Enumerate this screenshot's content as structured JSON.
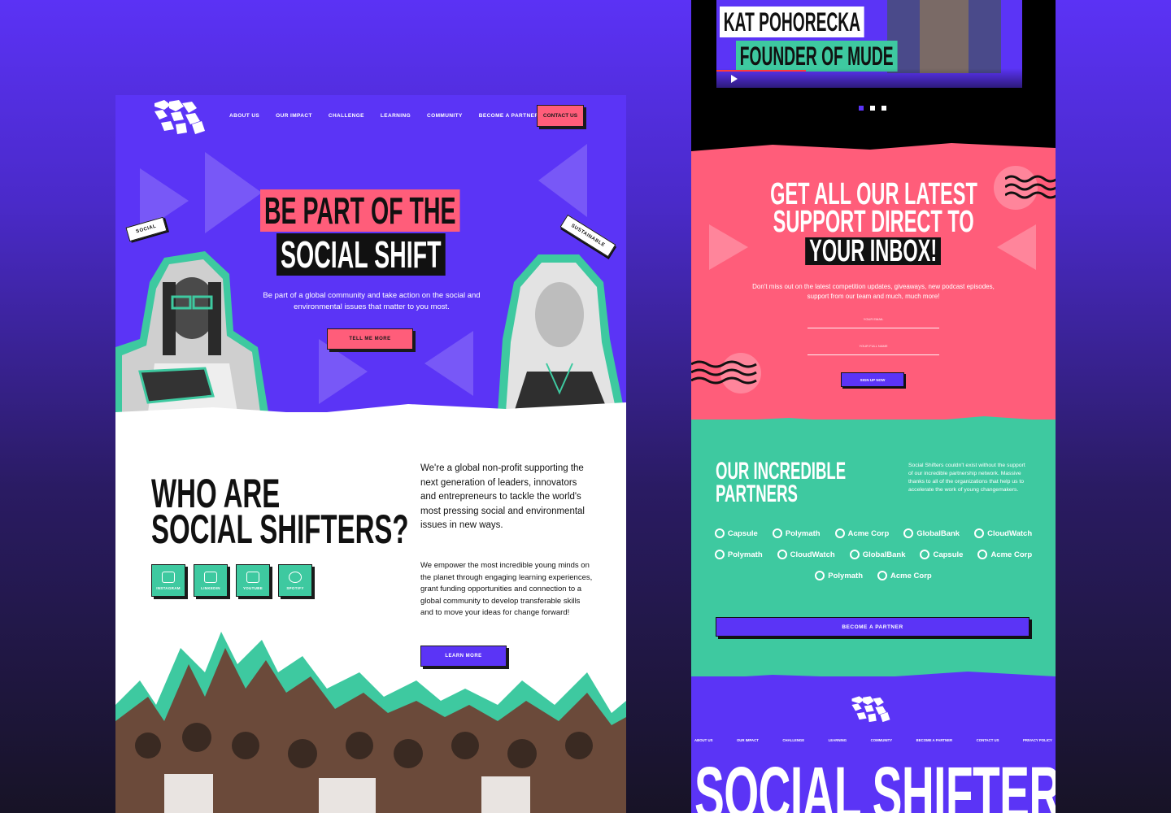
{
  "left_page": {
    "nav": {
      "items": [
        "ABOUT US",
        "OUR IMPACT",
        "CHALLENGE",
        "LEARNING",
        "COMMUNITY",
        "BECOME A PARTNER"
      ],
      "contact_label": "CONTACT US"
    },
    "hero": {
      "title_line1": "BE PART OF THE",
      "title_line2": "SOCIAL SHIFT",
      "subtitle": "Be part of a global community and take action on the social and environmental issues that matter to you most.",
      "cta_label": "TELL ME MORE",
      "tag_left": "SOCIAL",
      "tag_right": "SUSTAINABLE"
    },
    "who": {
      "title_line1": "WHO ARE",
      "title_line2": "SOCIAL SHIFTERS?",
      "para1": "We're a global non-profit supporting the next generation of leaders, innovators and entrepreneurs to tackle the world's most pressing social and environmental issues in new ways.",
      "para2": "We empower the most incredible young minds on the planet through engaging learning experiences, grant funding opportunities and connection to a global community to develop transferable skills and to move your ideas for change forward!",
      "cta_label": "LEARN MORE",
      "socials": [
        "INSTAGRAM",
        "LINKEDIN",
        "YOUTUBE",
        "SPOTIFY"
      ]
    }
  },
  "right_page": {
    "video": {
      "name_label": "KAT POHORECKA",
      "role_label": "FOUNDER OF MUDE"
    },
    "newsletter": {
      "title_line1": "GET ALL OUR LATEST",
      "title_line2": "SUPPORT DIRECT TO",
      "title_line3": "YOUR INBOX!",
      "subtitle": "Don't miss out on the latest competition updates, giveaways, new podcast episodes, support from our team and much, much more!",
      "email_placeholder": "YOUR EMAIL",
      "name_placeholder": "YOUR FULL NAME",
      "cta_label": "SIGN UP NOW"
    },
    "partners": {
      "title_line1": "OUR INCREDIBLE",
      "title_line2": "PARTNERS",
      "description": "Social Shifters couldn't exist without the support of our incredible partnership network. Massive thanks to all of the organizations that help us to accelerate the work of young changemakers.",
      "rows": [
        [
          "Capsule",
          "Polymath",
          "Acme Corp",
          "GlobalBank",
          "CloudWatch"
        ],
        [
          "Polymath",
          "CloudWatch",
          "GlobalBank",
          "Capsule",
          "Acme Corp"
        ],
        [
          "Polymath",
          "Acme Corp"
        ]
      ],
      "cta_label": "BECOME A PARTNER"
    },
    "footer": {
      "nav": [
        "ABOUT US",
        "OUR IMPACT",
        "CHALLENGE",
        "LEARNING",
        "COMMUNITY",
        "BECOME A PARTNER",
        "CONTACT US",
        "PRIVACY POLICY"
      ],
      "brand": "SOCIAL SHIFTERS"
    }
  },
  "colors": {
    "purple": "#5b34f6",
    "pink": "#ff5d7a",
    "teal": "#3ec9a0",
    "black": "#111111"
  }
}
